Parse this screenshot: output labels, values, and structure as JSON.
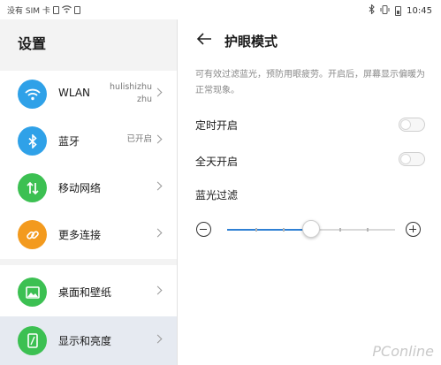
{
  "status_bar": {
    "carrier": "没有 SIM 卡",
    "time": "10:45"
  },
  "settings": {
    "title": "设置",
    "items": [
      {
        "label": "WLAN",
        "value_line1": "hulishizhu",
        "value_line2": "zhu",
        "icon": "wifi-icon",
        "color": "#2fa1e8"
      },
      {
        "label": "蓝牙",
        "value_line1": "已开启",
        "value_line2": "",
        "icon": "bluetooth-icon",
        "color": "#2fa1e8"
      },
      {
        "label": "移动网络",
        "value_line1": "",
        "value_line2": "",
        "icon": "mobile-data-icon",
        "color": "#3cc052"
      },
      {
        "label": "更多连接",
        "value_line1": "",
        "value_line2": "",
        "icon": "link-icon",
        "color": "#f39a1e"
      },
      {
        "label": "桌面和壁纸",
        "value_line1": "",
        "value_line2": "",
        "icon": "wallpaper-icon",
        "color": "#3cc052"
      },
      {
        "label": "显示和亮度",
        "value_line1": "",
        "value_line2": "",
        "icon": "display-icon",
        "color": "#3cc052",
        "selected": true
      }
    ]
  },
  "eye_comfort": {
    "title": "护眼模式",
    "description": "可有效过滤蓝光，预防用眼疲劳。开启后，屏幕显示偏暖为正常现象。",
    "scheduled_label": "定时开启",
    "scheduled_on": false,
    "all_day_label": "全天开启",
    "all_day_on": false,
    "filter_label": "蓝光过滤",
    "filter_level": 0.5,
    "filter_ticks": 5,
    "accent": "#2f80d4"
  },
  "watermark": "PConline"
}
